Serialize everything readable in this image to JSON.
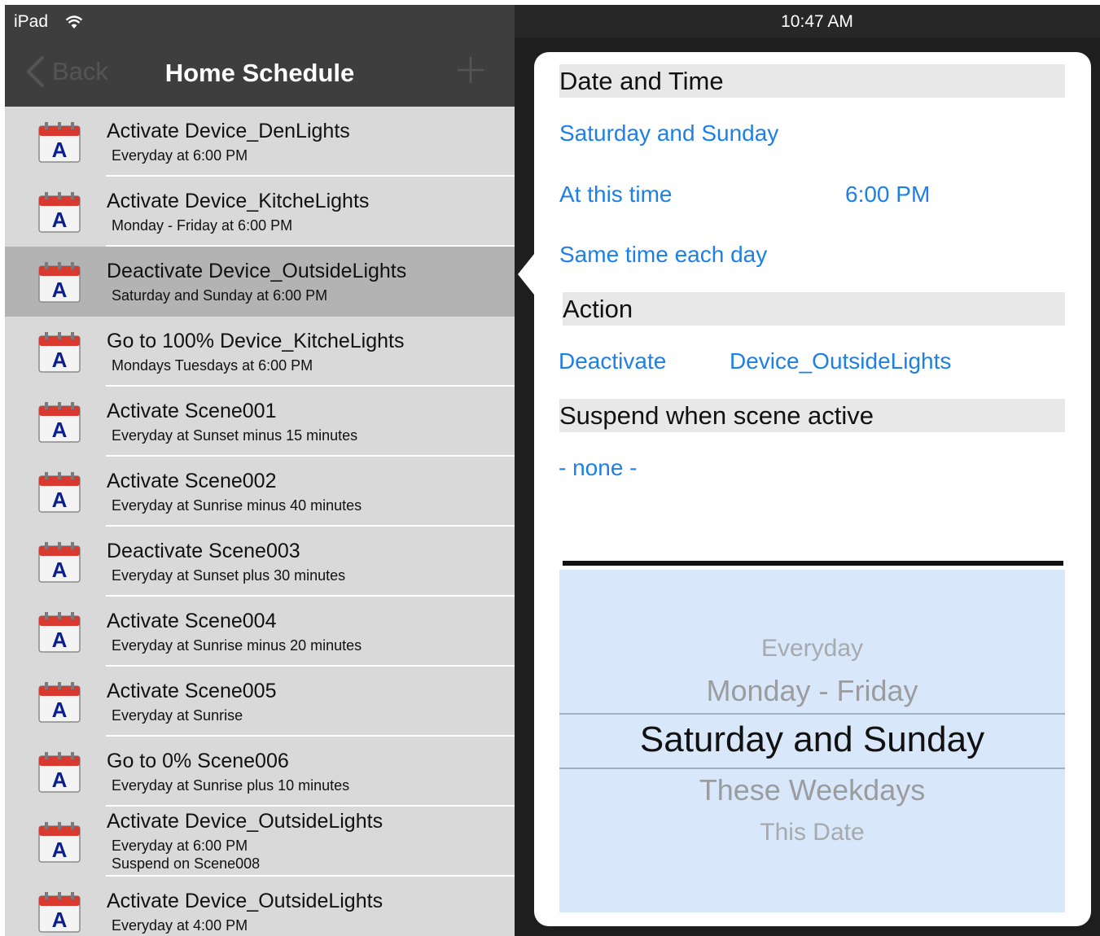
{
  "status_bar": {
    "carrier": "iPad",
    "time": "10:47 AM"
  },
  "nav_bar": {
    "back_label": "Back",
    "title": "Home Schedule"
  },
  "schedule_list": [
    {
      "title": "Activate Device_DenLights",
      "subtitle": "Everyday at 6:00 PM"
    },
    {
      "title": "Activate Device_KitcheLights",
      "subtitle": "Monday - Friday at 6:00 PM"
    },
    {
      "title": "Deactivate Device_OutsideLights",
      "subtitle": "Saturday and Sunday at 6:00 PM",
      "selected": true
    },
    {
      "title": "Go to 100% Device_KitcheLights",
      "subtitle": "Mondays Tuesdays at 6:00 PM"
    },
    {
      "title": "Activate Scene001",
      "subtitle": "Everyday at Sunset minus 15 minutes"
    },
    {
      "title": "Activate Scene002",
      "subtitle": "Everyday at Sunrise minus 40 minutes"
    },
    {
      "title": "Deactivate Scene003",
      "subtitle": "Everyday at Sunset plus 30 minutes"
    },
    {
      "title": "Activate Scene004",
      "subtitle": "Everyday at Sunrise minus 20 minutes"
    },
    {
      "title": "Activate Scene005",
      "subtitle": "Everyday at Sunrise"
    },
    {
      "title": "Go to 0% Scene006",
      "subtitle": "Everyday at Sunrise plus 10 minutes"
    },
    {
      "title": "Activate Device_OutsideLights",
      "subtitle": "Everyday at 6:00 PM",
      "subtitle2": "Suspend on Scene008"
    },
    {
      "title": "Activate Device_OutsideLights",
      "subtitle": "Everyday at 4:00 PM"
    }
  ],
  "row_icon_letter": "A",
  "detail": {
    "date_time_header": "Date and Time",
    "days_value": "Saturday and Sunday",
    "time_label": "At this time",
    "time_value": "6:00 PM",
    "time_mode": "Same time each day",
    "action_header": "Action",
    "action_verb": "Deactivate",
    "action_target": "Device_OutsideLights",
    "suspend_header": "Suspend when scene active",
    "suspend_value": "- none -"
  },
  "picker": {
    "options": [
      "Everyday",
      "Monday - Friday",
      "Saturday and Sunday",
      "These Weekdays",
      "This Date"
    ],
    "selected": "Saturday and Sunday"
  },
  "colors": {
    "link_blue": "#1e80e6",
    "picker_bg": "#d8e8fa",
    "list_bg": "#d9d9d9",
    "selected_row": "#b3b3b3",
    "calendar_red": "#d93a30",
    "calendar_letter": "#0b1f8c"
  }
}
